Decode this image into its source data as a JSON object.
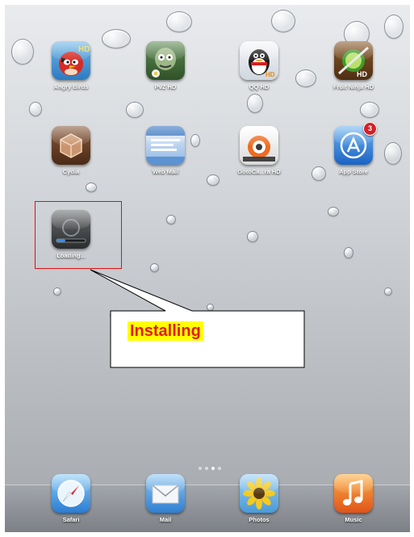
{
  "apps": [
    {
      "label": "Angry Birds"
    },
    {
      "label": "PvZ HD"
    },
    {
      "label": "QQ HD"
    },
    {
      "label": "Fruit Ninja HD"
    },
    {
      "label": "Cydia"
    },
    {
      "label": "Web Mail"
    },
    {
      "label": "GotoCa...ra HD"
    },
    {
      "label": "App Store",
      "badge": "3"
    },
    {
      "label": "Loading...",
      "progress": 0.3
    }
  ],
  "page_indicator": {
    "pages": 4,
    "current": 3
  },
  "dock": [
    {
      "label": "Safari"
    },
    {
      "label": "Mail"
    },
    {
      "label": "Photos"
    },
    {
      "label": "Music"
    }
  ],
  "callout": {
    "text": "Installing"
  },
  "colors": {
    "highlight": "#e01010",
    "callout_text": "#e31b1b",
    "callout_bg": "#ffff00",
    "badge": "#d81f26"
  }
}
